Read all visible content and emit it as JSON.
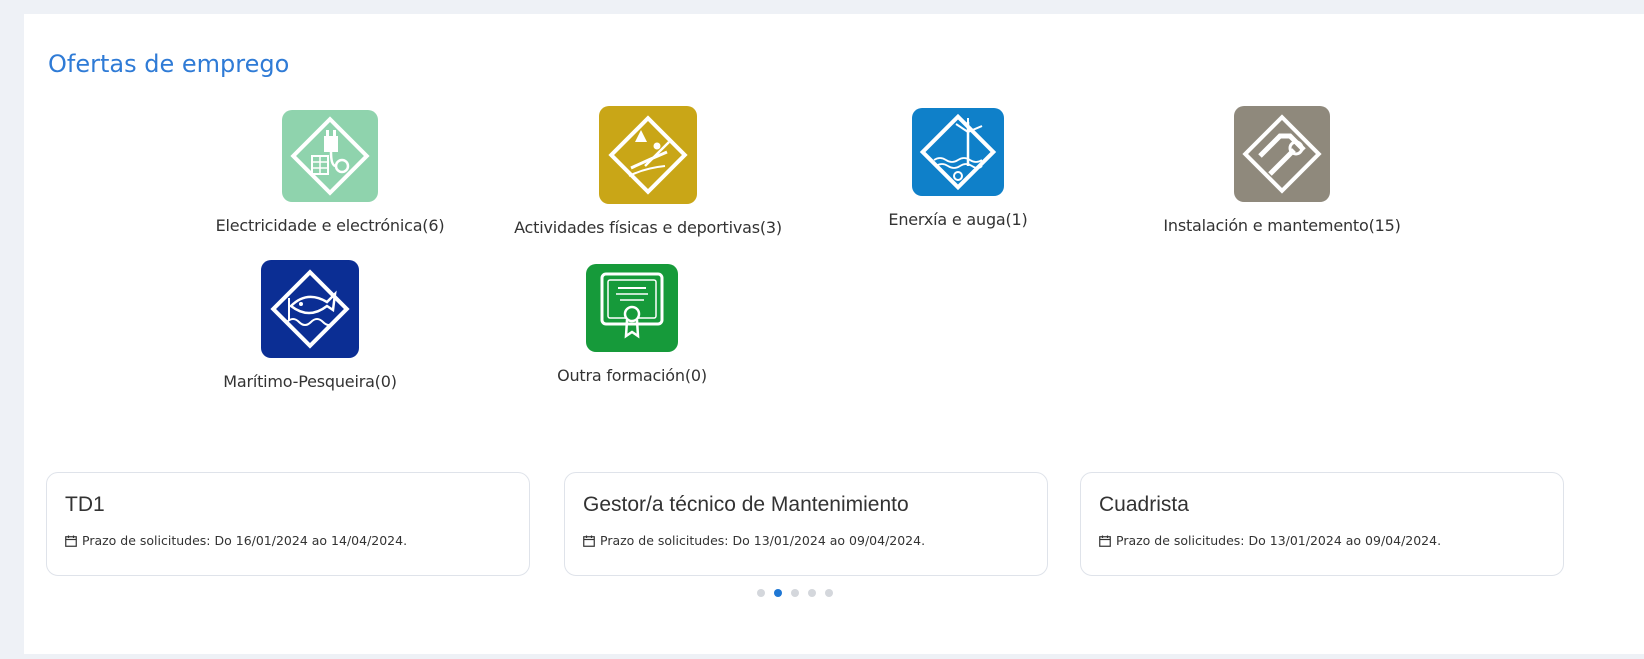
{
  "section": {
    "title": "Ofertas de emprego"
  },
  "categories": [
    {
      "label": "Electricidade e electrónica(6)",
      "color": "#8fd3ad",
      "icon": "plug-solar-icon"
    },
    {
      "label": "Actividades físicas e deportivas(3)",
      "color": "#c9a617",
      "icon": "kayak-icon"
    },
    {
      "label": "Enerxía e auga(1)",
      "color": "#0f80c9",
      "icon": "wind-turbine-icon"
    },
    {
      "label": "Instalación e mantemento(15)",
      "color": "#8f897c",
      "icon": "wrench-pipe-icon"
    },
    {
      "label": "Marítimo-Pesqueira(0)",
      "color": "#0b2e94",
      "icon": "fish-icon"
    },
    {
      "label": "Outra formación(0)",
      "color": "#169a3a",
      "icon": "certificate-icon"
    }
  ],
  "offers": [
    {
      "title": "TD1",
      "deadline": "Prazo de solicitudes: Do 16/01/2024 ao 14/04/2024."
    },
    {
      "title": "Gestor/a técnico de Mantenimiento",
      "deadline": "Prazo de solicitudes: Do 13/01/2024 ao 09/04/2024."
    },
    {
      "title": "Cuadrista",
      "deadline": "Prazo de solicitudes: Do 13/01/2024 ao 09/04/2024."
    }
  ],
  "carousel": {
    "pages": 5,
    "active_page": 2
  }
}
